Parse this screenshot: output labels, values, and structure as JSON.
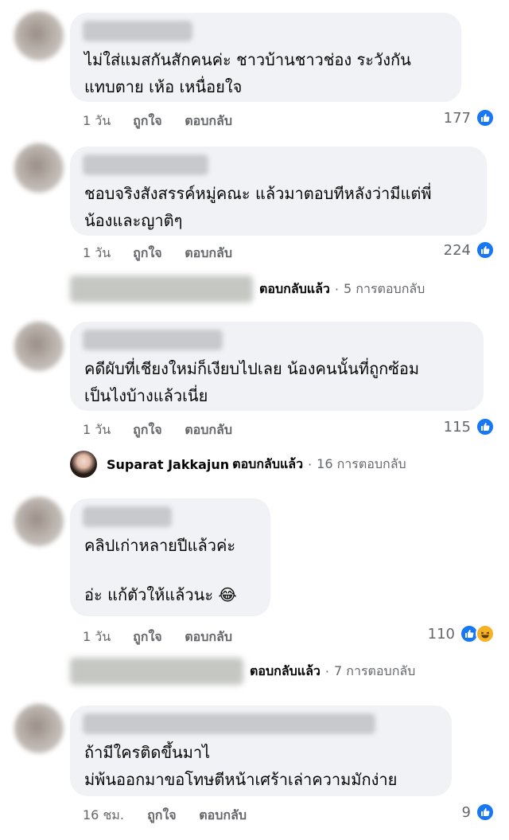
{
  "comments": [
    {
      "text_lines": [
        "ไม่ใส่แมสกันสักคนค่ะ ชาวบ้านชาวช่อง ระวังกัน",
        "แทบตาย เห้อ เหนื่อยใจ"
      ],
      "time": "1 วัน",
      "like": "ถูกใจ",
      "reply": "ตอบกลับ",
      "reactions": "177"
    },
    {
      "text_lines": [
        "ชอบจริงสังสรรค์หมู่คณะ แล้วมาตอบทีหลังว่ามีแต่พี่",
        "น้องและญาติๆ"
      ],
      "time": "1 วัน",
      "like": "ถูกใจ",
      "reply": "ตอบกลับ",
      "reactions": "224"
    },
    {
      "text_lines": [
        "คดีผับที่เชียงใหม่ก็เงียบไปเลย น้องคนนั้นที่ถูกซ้อม",
        "เป็นไงบ้างแล้วเนี่ย"
      ],
      "time": "1 วัน",
      "like": "ถูกใจ",
      "reply": "ตอบกลับ",
      "reactions": "115"
    },
    {
      "text_lines": [
        "คลิปเก่าหลายปีแล้วค่ะ",
        "",
        "อ่ะ แก้ตัวให้แล้วนะ 😂"
      ],
      "time": "1 วัน",
      "like": "ถูกใจ",
      "reply": "ตอบกลับ",
      "reactions": "110"
    },
    {
      "text_lines": [
        "ถ้ามีใครติดขึ้นมาไ",
        "ม่พ้นออกมาขอโทษตีหน้าเศร้าเล่าความมักง่าย"
      ],
      "time": "16 ชม.",
      "like": "ถูกใจ",
      "reply": "ตอบกลับ",
      "reactions": "9"
    }
  ],
  "reply_threads": [
    {
      "name": "",
      "action": "ตอบกลับแล้ว",
      "count": "5 การตอบกลับ"
    },
    {
      "name": "Suparat Jakkajun",
      "action": "ตอบกลับแล้ว",
      "count": "16 การตอบกลับ"
    },
    {
      "name": "",
      "action": "ตอบกลับแล้ว",
      "count": "7 การตอบกลับ"
    }
  ],
  "separator": "·",
  "colors": {
    "like_blue": "#1877f2",
    "haha_yellow": "#f7b125",
    "bubble_bg": "#f0f2f5",
    "meta_gray": "#65676b"
  }
}
